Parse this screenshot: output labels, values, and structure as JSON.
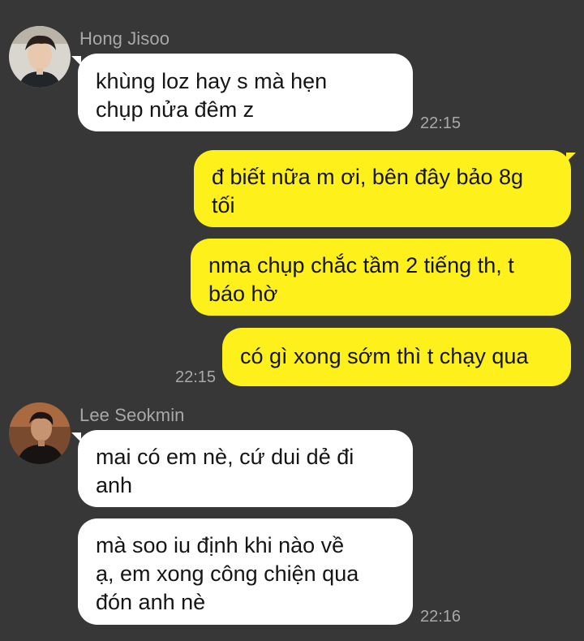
{
  "colors": {
    "background": "#373737",
    "incoming_bubble": "#ffffff",
    "outgoing_bubble": "#fef01b",
    "meta_text": "#a8a8a8"
  },
  "messages": {
    "group1": {
      "sender": "Hong Jisoo",
      "avatar_icon": "profile-photo",
      "bubble1": "khùng loz hay s mà hẹn\nchụp nửa đêm z",
      "time": "22:15"
    },
    "group2": {
      "bubble1": "đ biết nữa m ơi, bên đây bảo 8g\ntối",
      "bubble2": "nma chụp chắc tầm 2 tiếng th, t\nbáo hờ",
      "bubble3": "có gì xong sớm thì t chạy qua",
      "time": "22:15"
    },
    "group3": {
      "sender": "Lee Seokmin",
      "avatar_icon": "profile-photo",
      "bubble1": "mai có em nè, cứ dui dẻ đi\nanh",
      "bubble2": "mà soo iu định khi nào về\nạ, em xong công chiện qua\nđón anh nè",
      "time": "22:16"
    }
  }
}
